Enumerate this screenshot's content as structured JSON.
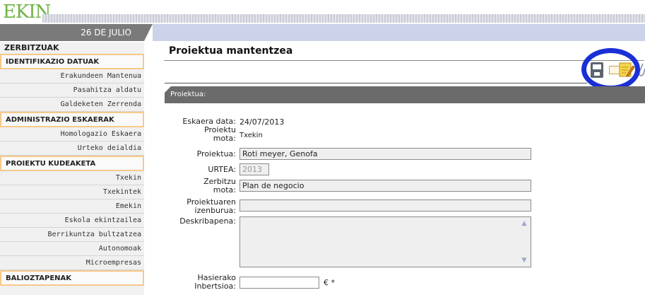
{
  "header": {
    "logo": "EKIN",
    "date": "26 DE JULIO"
  },
  "sidebar": {
    "title": "ZERBITZUAK",
    "sections": [
      {
        "label": "IDENTIFIKAZIO DATUAK",
        "items": [
          "Erakundeen Mantenua",
          "Pasahitza aldatu",
          "Galdeketen Zerrenda"
        ]
      },
      {
        "label": "ADMINISTRAZIO ESKAERAK",
        "items": [
          "Homologazio Eskaera",
          "Urteko deialdia"
        ]
      },
      {
        "label": "PROIEKTU KUDEAKETA",
        "items": [
          "Txekin",
          "Txekintek",
          "Emekin",
          "Eskola ekintzailea",
          "Berrikuntza bultzatzea",
          "Autonomoak",
          "Microempresas"
        ]
      },
      {
        "label": "BALIOZTAPENAK",
        "items": []
      }
    ]
  },
  "main": {
    "title": "Proiektua mantentzea",
    "section_label": "Proiektua:",
    "fields": {
      "eskaera_data": {
        "label": "Eskaera data:",
        "value": "24/07/2013"
      },
      "proiektu_mota": {
        "label_a": "Proiektu",
        "label_b": "mota:",
        "value": "Txekin"
      },
      "proiektua": {
        "label": "Proiektua:",
        "value": "Roti meyer, Genofa"
      },
      "urtea": {
        "label": "URTEA:",
        "value": "2013"
      },
      "zerbitzu_mota": {
        "label_a": "Zerbitzu",
        "label_b": "mota:",
        "value": "Plan de negocio"
      },
      "izenburua": {
        "label_a": "Proiektuaren",
        "label_b": "izenburua:",
        "value": ""
      },
      "deskribapena": {
        "label": "Deskribapena:",
        "value": ""
      },
      "inbertsioa": {
        "label_a": "Hasierako",
        "label_b": "Inbertsioa:",
        "value": "",
        "suffix": "€ *"
      }
    }
  },
  "icons": [
    "save-icon",
    "mail-icon",
    "edit-icon",
    "clip-icon"
  ],
  "colors": {
    "logo": "#6fb347",
    "highlight": "#1a2fd6",
    "section_bar": "#6b6b6b",
    "sidebar_section_border": "#f6c98c"
  }
}
